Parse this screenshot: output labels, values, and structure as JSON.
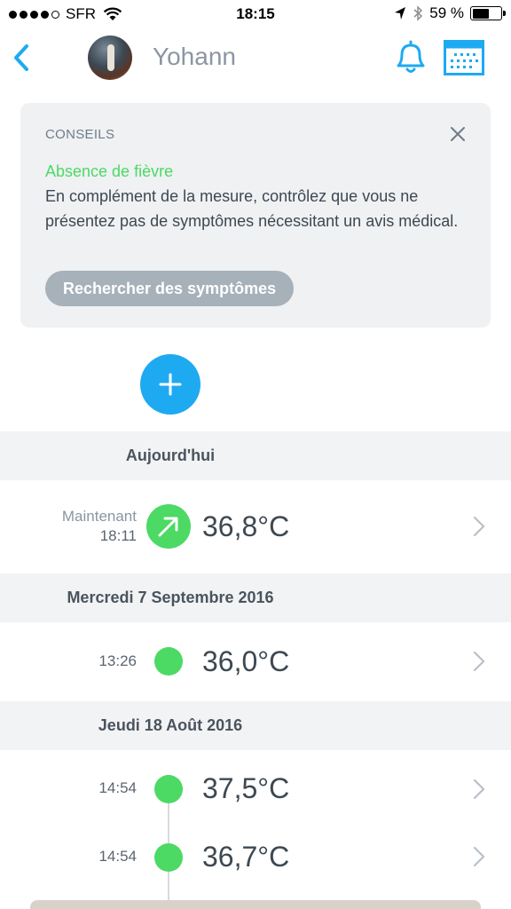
{
  "status_bar": {
    "carrier": "SFR",
    "time": "18:15",
    "battery_text": "59 %",
    "battery_level": 0.59
  },
  "nav": {
    "username": "Yohann"
  },
  "advice_card": {
    "title": "CONSEILS",
    "heading": "Absence de fièvre",
    "body": "En complément de la mesure, contrôlez que vous ne présentez pas de symptômes nécessitant un avis médical.",
    "button": "Rechercher des symptômes"
  },
  "colors": {
    "accent": "#1eaaf1",
    "normal_green": "#4cd964",
    "card_bg": "#eff1f3",
    "button_gray": "#a6b1ba"
  },
  "sections": [
    {
      "label": "Aujourd'hui",
      "rows": [
        {
          "label": "Maintenant",
          "time": "18:11",
          "temp": "36,8°C",
          "icon": "trend-up-arrow-icon"
        }
      ]
    },
    {
      "label": "Mercredi 7 Septembre 2016",
      "rows": [
        {
          "time": "13:26",
          "temp": "36,0°C"
        }
      ]
    },
    {
      "label": "Jeudi 18 Août 2016",
      "rows": [
        {
          "time": "14:54",
          "temp": "37,5°C"
        },
        {
          "time": "14:54",
          "temp": "36,7°C"
        }
      ]
    }
  ]
}
